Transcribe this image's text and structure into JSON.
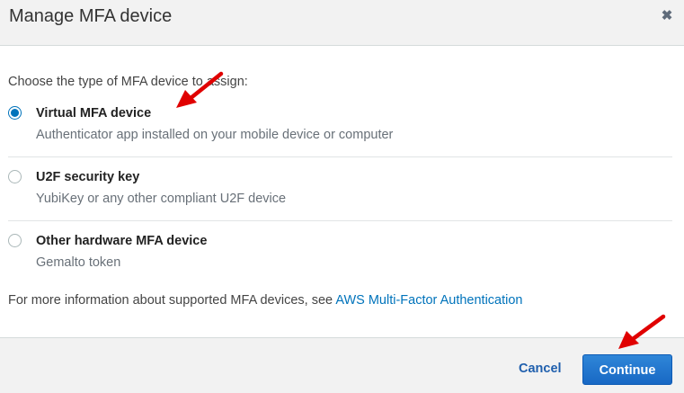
{
  "dialog": {
    "title": "Manage MFA device",
    "close_icon": "close-icon"
  },
  "body": {
    "prompt": "Choose the type of MFA device to assign:",
    "options": [
      {
        "label": "Virtual MFA device",
        "description": "Authenticator app installed on your mobile device or computer",
        "selected": true
      },
      {
        "label": "U2F security key",
        "description": "YubiKey or any other compliant U2F device",
        "selected": false
      },
      {
        "label": "Other hardware MFA device",
        "description": "Gemalto token",
        "selected": false
      }
    ],
    "info_text": "For more information about supported MFA devices, see ",
    "info_link": "AWS Multi-Factor Authentication"
  },
  "footer": {
    "cancel_label": "Cancel",
    "continue_label": "Continue"
  },
  "colors": {
    "accent": "#0073bb",
    "annotation_arrow": "#e00000",
    "primary_button": "#1f74cf"
  }
}
